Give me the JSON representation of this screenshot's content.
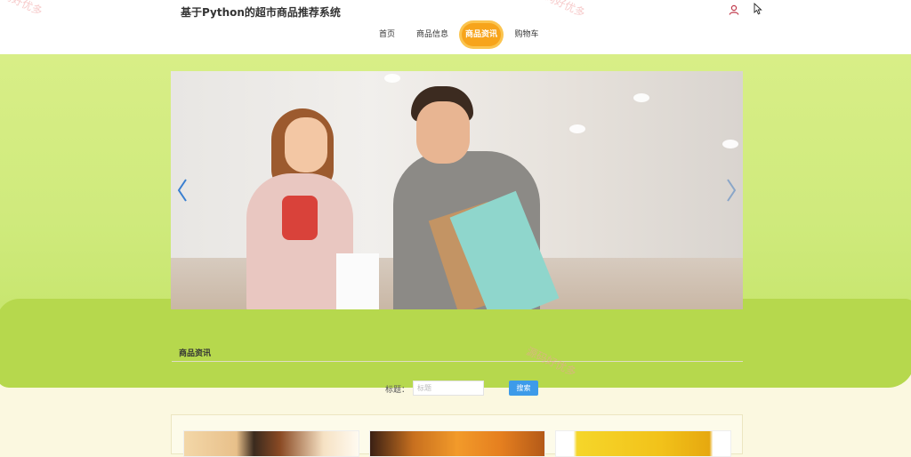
{
  "header": {
    "title": "基于Python的超市商品推荐系统",
    "user_icon": "user-icon"
  },
  "nav": {
    "items": [
      {
        "label": "首页",
        "active": false
      },
      {
        "label": "商品信息",
        "active": false
      },
      {
        "label": "商品资讯",
        "active": true
      },
      {
        "label": "购物车",
        "active": false
      }
    ]
  },
  "carousel": {
    "prev_icon": "chevron-left-icon",
    "next_icon": "chevron-right-icon"
  },
  "section": {
    "title": "商品资讯"
  },
  "search": {
    "label": "标题：",
    "placeholder": "标题",
    "button_label": "搜索"
  },
  "colors": {
    "accent": "#f7a41b",
    "banner_green": "#b6d84d",
    "search_button": "#3d9be9"
  },
  "watermarks": [
    "源码好优多",
    "源码好优多",
    "源码好优多"
  ]
}
